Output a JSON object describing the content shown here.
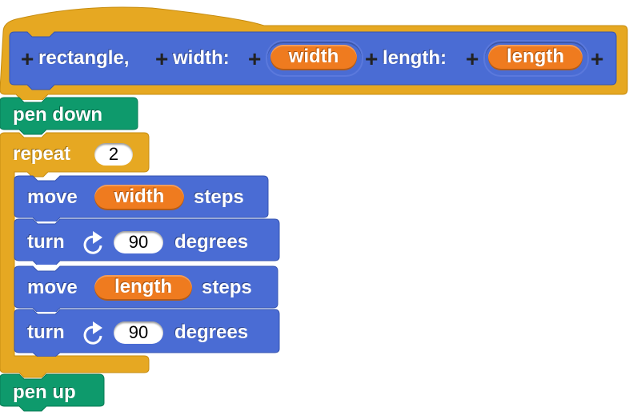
{
  "hat_block": {
    "parts": [
      "rectangle,",
      "width:",
      "length:"
    ],
    "params": [
      "width",
      "length"
    ],
    "color": "#e6a822"
  },
  "blocks": {
    "pen_down": {
      "label": "pen down",
      "color": "#0e9a6c"
    },
    "repeat": {
      "label": "repeat",
      "count": "2",
      "color": "#e6a822"
    },
    "move1": {
      "label": "move",
      "arg": "width",
      "suffix": "steps"
    },
    "turn1": {
      "label": "turn",
      "arg": "90",
      "suffix": "degrees",
      "icon": "rotate-clockwise-icon"
    },
    "move2": {
      "label": "move",
      "arg": "length",
      "suffix": "steps"
    },
    "turn2": {
      "label": "turn",
      "arg": "90",
      "suffix": "degrees",
      "icon": "rotate-clockwise-icon"
    },
    "pen_up": {
      "label": "pen up",
      "color": "#0e9a6c"
    }
  },
  "colors": {
    "motion": "#4a6cd4",
    "variable": "#ef7b1f",
    "control": "#e6a822",
    "pen": "#0e9a6c"
  }
}
